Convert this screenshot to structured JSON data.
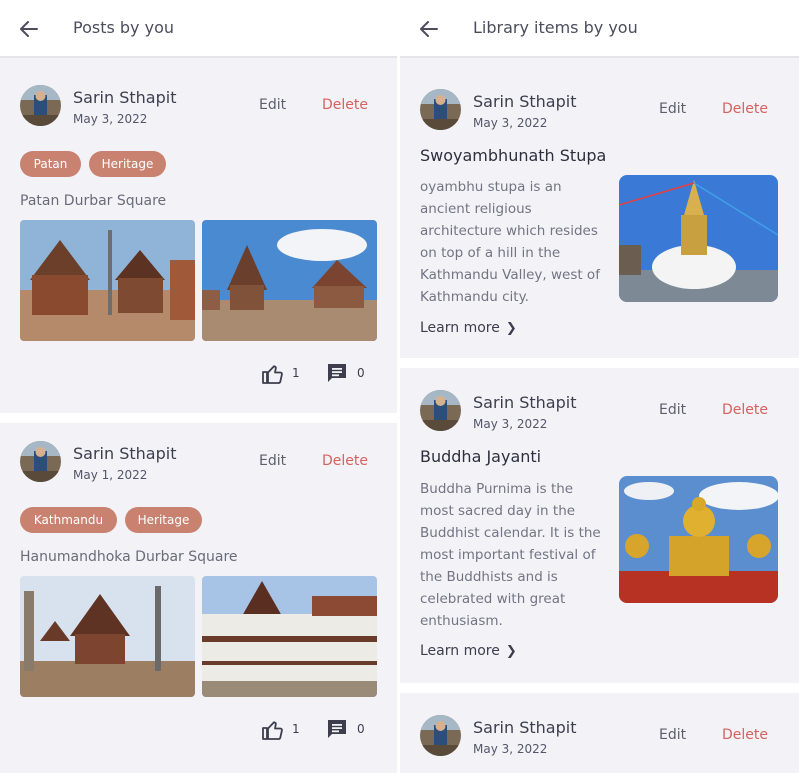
{
  "left": {
    "title": "Posts by you",
    "posts": [
      {
        "author": "Sarin Sthapit",
        "date": "May 3, 2022",
        "edit_label": "Edit",
        "delete_label": "Delete",
        "tags": [
          "Patan",
          "Heritage"
        ],
        "place": "Patan Durbar Square",
        "likes": "1",
        "comments": "0"
      },
      {
        "author": "Sarin Sthapit",
        "date": "May 1, 2022",
        "edit_label": "Edit",
        "delete_label": "Delete",
        "tags": [
          "Kathmandu",
          "Heritage"
        ],
        "place": "Hanumandhoka Durbar Square",
        "likes": "1",
        "comments": "0"
      }
    ]
  },
  "right": {
    "title": "Library items by you",
    "items": [
      {
        "author": "Sarin Sthapit",
        "date": "May 3, 2022",
        "edit_label": "Edit",
        "delete_label": "Delete",
        "title": "Swoyambhunath Stupa",
        "description": "oyambhu stupa is an ancient religious architecture which resides on top of a hill in the Kathmandu Valley, west of Kathmandu city.",
        "learn_more": "Learn more"
      },
      {
        "author": "Sarin Sthapit",
        "date": "May 3, 2022",
        "edit_label": "Edit",
        "delete_label": "Delete",
        "title": "Buddha Jayanti",
        "description": "Buddha Purnima is the most sacred day in the Buddhist calendar. It is the most important festival of the Buddhists and is celebrated with great enthusiasm.",
        "learn_more": "Learn more"
      },
      {
        "author": "Sarin Sthapit",
        "date": "May 3, 2022",
        "edit_label": "Edit",
        "delete_label": "Delete"
      }
    ]
  },
  "colors": {
    "tag_bg": "#c8826f",
    "delete_text": "#d4625e",
    "background": "#f3f3f7"
  },
  "icons": [
    "back-arrow-icon",
    "thumbs-up-icon",
    "comment-icon",
    "chevron-right-icon"
  ]
}
